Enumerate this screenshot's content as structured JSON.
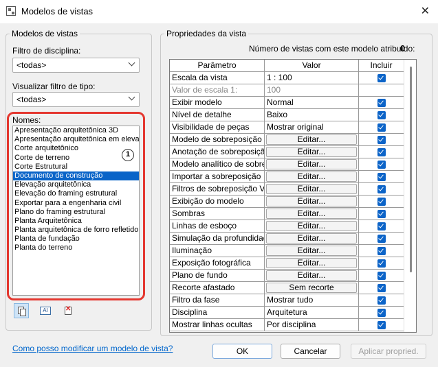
{
  "window": {
    "title": "Modelos de vistas"
  },
  "left_group": {
    "title": "Modelos de vistas",
    "discipline_filter_label": "Filtro de disciplina:",
    "discipline_filter_value": "<todas>",
    "type_filter_label": "Visualizar filtro de tipo:",
    "type_filter_value": "<todas>",
    "names_label": "Nomes:",
    "names": [
      "Apresentação arquitetônica 3D",
      "Apresentação arquitetônica em elevação",
      "Corte arquitetônico",
      "Corte de terreno",
      "Corte Estrutural",
      "Documento de construção",
      "Elevação arquitetônica",
      "Elevação do framing estrutural",
      "Exportar para a engenharia civil",
      "Plano do framing estrutural",
      "Planta Arquitetônica",
      "Planta arquitetônica de forro refletido",
      "Planta de fundação",
      "Planta do terreno"
    ],
    "selected_index": 5,
    "callout_badge": "1",
    "tool_ren_glyph": "AI"
  },
  "right_group": {
    "title": "Propriedades da vista",
    "count_label": "Número de vistas com este modelo atribuído:",
    "count_value": "0",
    "columns": {
      "param": "Parâmetro",
      "value": "Valor",
      "include": "Incluir"
    },
    "rows": [
      {
        "param": "Escala da vista",
        "value": "1 : 100",
        "type": "text",
        "include": true
      },
      {
        "param": "Valor de escala    1:",
        "value": "100",
        "type": "grey",
        "include": null
      },
      {
        "param": "Exibir modelo",
        "value": "Normal",
        "type": "text",
        "include": true
      },
      {
        "param": "Nível de detalhe",
        "value": "Baixo",
        "type": "text",
        "include": true
      },
      {
        "param": "Visibilidade de peças",
        "value": "Mostrar original",
        "type": "text",
        "include": true
      },
      {
        "param": "Modelo de sobreposição",
        "value": "Editar...",
        "type": "button",
        "include": true
      },
      {
        "param": "Anotação de sobreposição",
        "value": "Editar...",
        "type": "button",
        "include": true
      },
      {
        "param": "Modelo analítico de sobreposição",
        "value": "Editar...",
        "type": "button",
        "include": true
      },
      {
        "param": "Importar a sobreposição",
        "value": "Editar...",
        "type": "button",
        "include": true
      },
      {
        "param": "Filtros de sobreposição V/G",
        "value": "Editar...",
        "type": "button",
        "include": true
      },
      {
        "param": "Exibição do modelo",
        "value": "Editar...",
        "type": "button",
        "include": true
      },
      {
        "param": "Sombras",
        "value": "Editar...",
        "type": "button",
        "include": true
      },
      {
        "param": "Linhas de esboço",
        "value": "Editar...",
        "type": "button",
        "include": true
      },
      {
        "param": "Simulação da profundidade",
        "value": "Editar...",
        "type": "button",
        "include": true
      },
      {
        "param": "Iluminação",
        "value": "Editar...",
        "type": "button",
        "include": true
      },
      {
        "param": "Exposição fotográfica",
        "value": "Editar...",
        "type": "button",
        "include": true
      },
      {
        "param": "Plano de fundo",
        "value": "Editar...",
        "type": "button",
        "include": true
      },
      {
        "param": "Recorte afastado",
        "value": "Sem recorte",
        "type": "button",
        "include": true
      },
      {
        "param": "Filtro da fase",
        "value": "Mostrar tudo",
        "type": "text",
        "include": true
      },
      {
        "param": "Disciplina",
        "value": "Arquitetura",
        "type": "text",
        "include": true
      },
      {
        "param": "Mostrar linhas ocultas",
        "value": "Por disciplina",
        "type": "text",
        "include": true
      }
    ]
  },
  "footer": {
    "help_link": "Como posso modificar um modelo de vista?",
    "ok": "OK",
    "cancel": "Cancelar",
    "apply": "Aplicar propried."
  }
}
